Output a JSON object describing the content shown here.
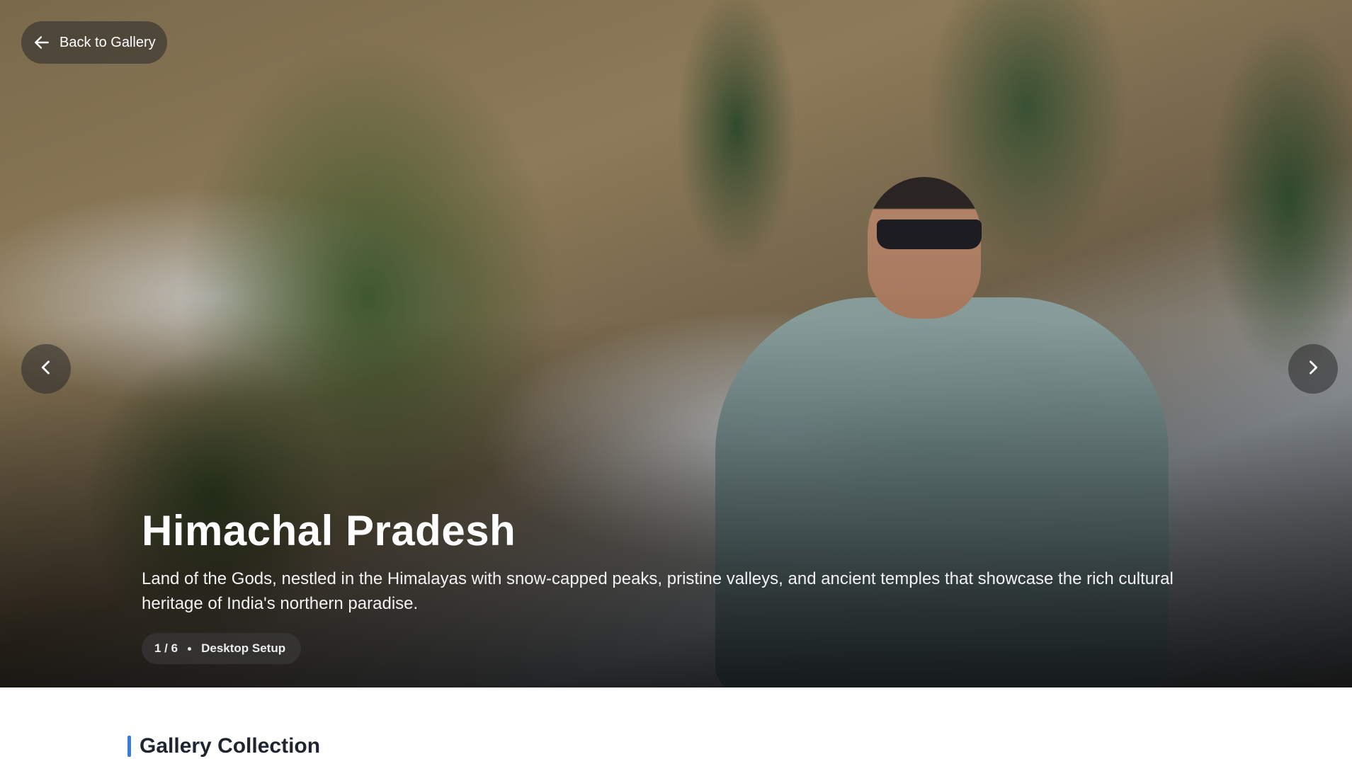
{
  "nav": {
    "back_label": "Back to Gallery",
    "back_icon": "arrow-left-icon",
    "prev_icon": "chevron-left-icon",
    "next_icon": "chevron-right-icon"
  },
  "slide": {
    "title": "Himachal Pradesh",
    "description": "Land of the Gods, nestled in the Himalayas with snow-capped peaks, pristine valleys, and ancient temples that showcase the rich cultural heritage of India's northern paradise.",
    "counter": "1 / 6",
    "tag": "Desktop Setup"
  },
  "section": {
    "title": "Gallery Collection"
  },
  "colors": {
    "accent": "#3b7ddd",
    "overlay_button": "rgba(40,40,40,0.55)",
    "text_on_image": "#ffffff"
  }
}
